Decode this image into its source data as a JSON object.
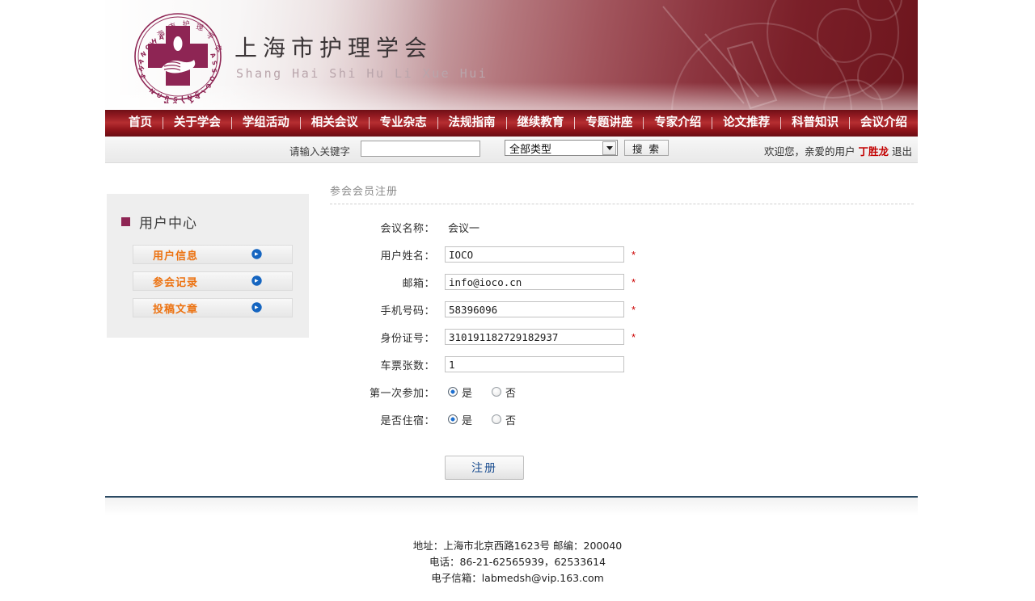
{
  "site": {
    "org_name_cn": "上海市护理学会",
    "org_name_pinyin": "Shang Hai Shi Hu Li Xue Hui",
    "logo_alt": "shanghai-nursing-association-logo"
  },
  "nav": {
    "items": [
      {
        "label": "首页"
      },
      {
        "label": "关于学会"
      },
      {
        "label": "学组活动"
      },
      {
        "label": "相关会议"
      },
      {
        "label": "专业杂志"
      },
      {
        "label": "法规指南"
      },
      {
        "label": "继续教育"
      },
      {
        "label": "专题讲座"
      },
      {
        "label": "专家介绍"
      },
      {
        "label": "论文推荐"
      },
      {
        "label": "科普知识"
      },
      {
        "label": "会议介绍"
      }
    ]
  },
  "search": {
    "label": "请输入关键字",
    "value": "",
    "placeholder": "",
    "type_selected": "全部类型",
    "type_options": [
      "全部类型"
    ],
    "button_label": "搜 索"
  },
  "account": {
    "greeting_prefix": "欢迎您，亲爱的用户 ",
    "username": "丁胜龙",
    "logout_label": " 退出"
  },
  "sidebar": {
    "title": "用户中心",
    "items": [
      {
        "label": "用户信息",
        "icon": "arrow-right-circle-icon"
      },
      {
        "label": "参会记录",
        "icon": "arrow-right-circle-icon"
      },
      {
        "label": "投稿文章",
        "icon": "arrow-right-circle-icon"
      }
    ]
  },
  "form": {
    "title": "参会会员注册",
    "meeting_label": "会议名称：",
    "meeting_value": "会议一",
    "fields": [
      {
        "label": "用户姓名：",
        "value": "IOCO",
        "required_mark": "*"
      },
      {
        "label": "邮箱：",
        "value": "info@ioco.cn",
        "required_mark": "*"
      },
      {
        "label": "手机号码：",
        "value": "58396096",
        "required_mark": "*"
      },
      {
        "label": "身份证号：",
        "value": "310191182729182937",
        "required_mark": "*"
      },
      {
        "label": "车票张数：",
        "value": "1",
        "required_mark": ""
      }
    ],
    "radios": [
      {
        "label": "第一次参加：",
        "options": [
          {
            "label": "是",
            "selected": true
          },
          {
            "label": "否",
            "selected": false
          }
        ]
      },
      {
        "label": "是否住宿：",
        "options": [
          {
            "label": "是",
            "selected": true
          },
          {
            "label": "否",
            "selected": false
          }
        ]
      }
    ],
    "submit_label": "注册"
  },
  "footer": {
    "line1": "地址：上海市北京西路1623号 邮编：200040",
    "line2": "电话：86-21-62565939，62533614",
    "line3": "电子信箱：labmedsh@vip.163.com"
  },
  "colors": {
    "brand_maroon": "#8e2554",
    "nav_red": "#911a21",
    "accent_orange": "#ec7211",
    "link_blue": "#1d4f91",
    "required_red": "#cc0000",
    "username_red": "#c20000",
    "rule_blue": "#2b4a63"
  }
}
